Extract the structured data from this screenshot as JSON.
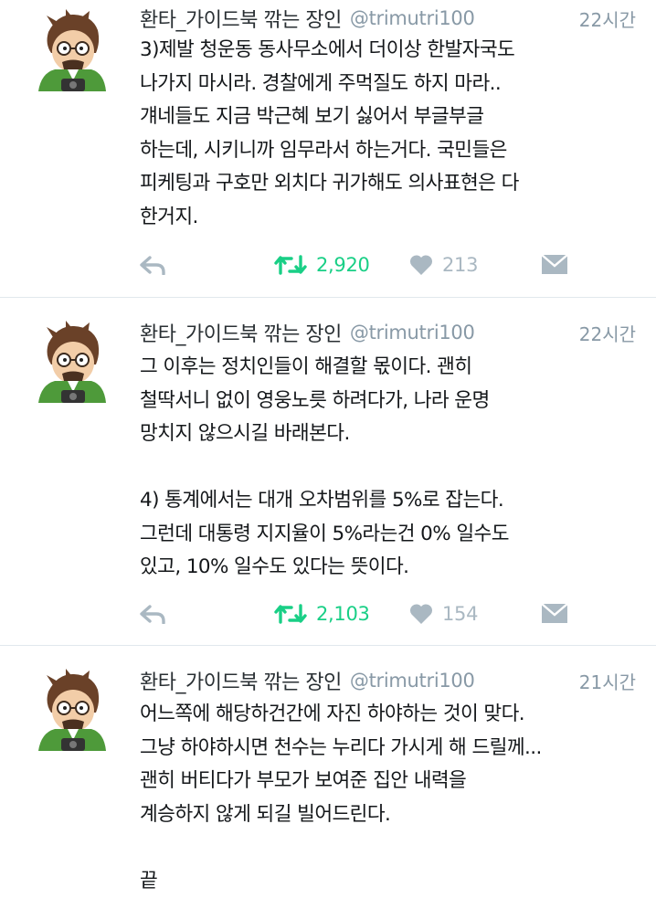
{
  "colors": {
    "retweet": "#19cf86",
    "muted": "#aab8c2",
    "handle": "#8899a6",
    "divider": "#e1e8ed"
  },
  "icons": {
    "reply": "reply-icon",
    "retweet": "retweet-icon",
    "like": "heart-icon",
    "message": "envelope-icon"
  },
  "tweets": [
    {
      "name": "환타_가이드북 깎는 장인",
      "handle": "@trimutri100",
      "time": "22시간",
      "text": "3)제발 청운동 동사무소에서 더이상 한발자국도\n나가지 마시라. 경찰에게 주먹질도 하지 마라..\n걔네들도 지금 박근혜 보기 싫어서 부글부글\n하는데, 시키니까 임무라서 하는거다. 국민들은\n피케팅과 구호만 외치다 귀가해도 의사표현은 다\n한거지.",
      "retweets": "2,920",
      "likes": "213"
    },
    {
      "name": "환타_가이드북 깎는 장인",
      "handle": "@trimutri100",
      "time": "22시간",
      "text": "그 이후는 정치인들이 해결할 몫이다. 괜히\n철딱서니 없이 영웅노릇 하려다가, 나라 운명\n망치지 않으시길 바래본다.\n\n4) 통계에서는 대개 오차범위를 5%로 잡는다.\n그런데 대통령 지지율이 5%라는건 0% 일수도\n있고, 10% 일수도 있다는 뜻이다.",
      "retweets": "2,103",
      "likes": "154"
    },
    {
      "name": "환타_가이드북 깎는 장인",
      "handle": "@trimutri100",
      "time": "21시간",
      "text": "어느쪽에 해당하건간에 자진 하야하는 것이 맞다.\n그냥 하야하시면 천수는 누리다 가시게 해 드릴께...\n괜히 버티다가 부모가 보여준 집안 내력을\n계승하지 않게 되길 빌어드린다.\n\n끝"
    }
  ]
}
